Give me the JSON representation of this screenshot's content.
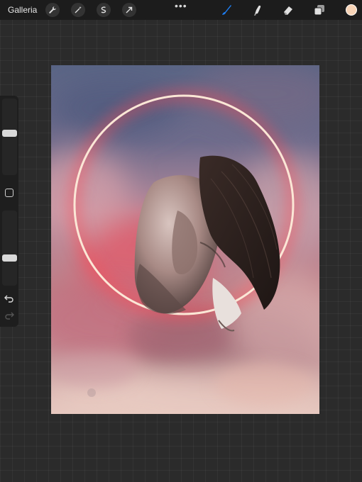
{
  "topbar": {
    "gallery_label": "Galleria",
    "left_tools": [
      "wrench-icon",
      "magic-wand-icon",
      "selection-icon",
      "transform-arrow-icon"
    ],
    "more_label": "•••",
    "right_tools": [
      "brush-icon",
      "smudge-icon",
      "eraser-icon",
      "layers-icon"
    ],
    "active_tool": "brush-icon",
    "accent_color": "#1e7df0",
    "current_color": "#f6d3b6"
  },
  "sidebar": {
    "brush_size_level": 0.55,
    "opacity_level": 0.35,
    "icons": [
      "modify-square-icon",
      "undo-icon",
      "redo-icon"
    ]
  },
  "canvas": {
    "description_colors": {
      "sky_top": "#5a6585",
      "cloud_pink": "#d98b93",
      "ring": "#fbe7d6",
      "ring_glow": "#ff4a55"
    }
  }
}
